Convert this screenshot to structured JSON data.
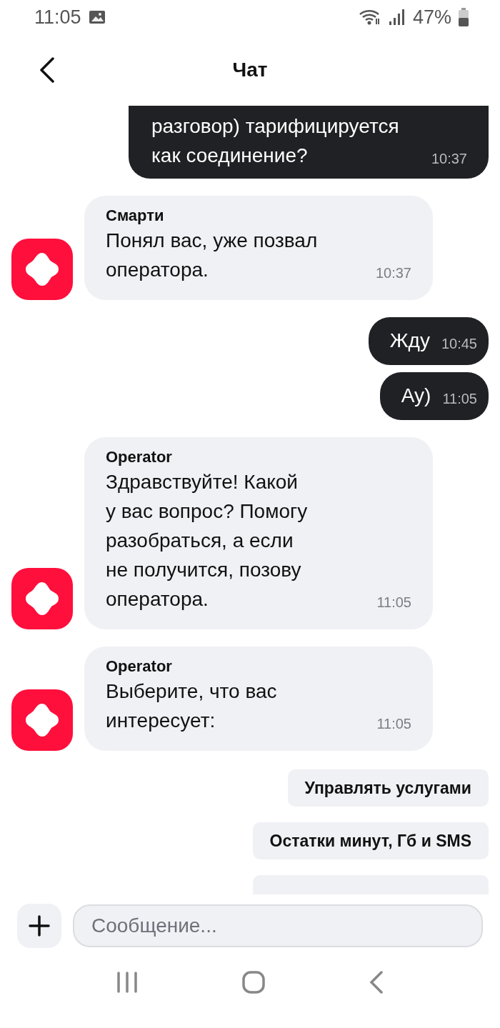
{
  "status_bar": {
    "time": "11:05",
    "battery": "47%"
  },
  "header": {
    "title": "Чат"
  },
  "messages": [
    {
      "kind": "outgoing",
      "lines": [
        "разговор) тарифицируется",
        "как соединение?"
      ],
      "time": "10:37",
      "cut": true
    },
    {
      "kind": "incoming",
      "name": "Смарти",
      "lines": [
        "Понял вас, уже позвал",
        "оператора."
      ],
      "time": "10:37"
    },
    {
      "kind": "outgoing",
      "lines": [
        "Жду"
      ],
      "time": "10:45"
    },
    {
      "kind": "outgoing",
      "lines": [
        "Ау)"
      ],
      "time": "11:05"
    },
    {
      "kind": "incoming",
      "name": "Operator",
      "lines": [
        "Здравствуйте! Какой",
        "у вас вопрос? Помогу",
        "разобраться, а если",
        "не получится, позову",
        "оператора."
      ],
      "time": "11:05"
    },
    {
      "kind": "incoming",
      "name": "Operator",
      "lines": [
        "Выберите, что вас",
        "интересует:"
      ],
      "time": "11:05"
    }
  ],
  "quick_replies": [
    {
      "kind": "text",
      "label": "Управлять услугами"
    },
    {
      "kind": "text",
      "label": "Остатки минут, Гб и SMS"
    },
    {
      "kind": "cut"
    }
  ],
  "composer": {
    "placeholder": "Сообщение..."
  }
}
